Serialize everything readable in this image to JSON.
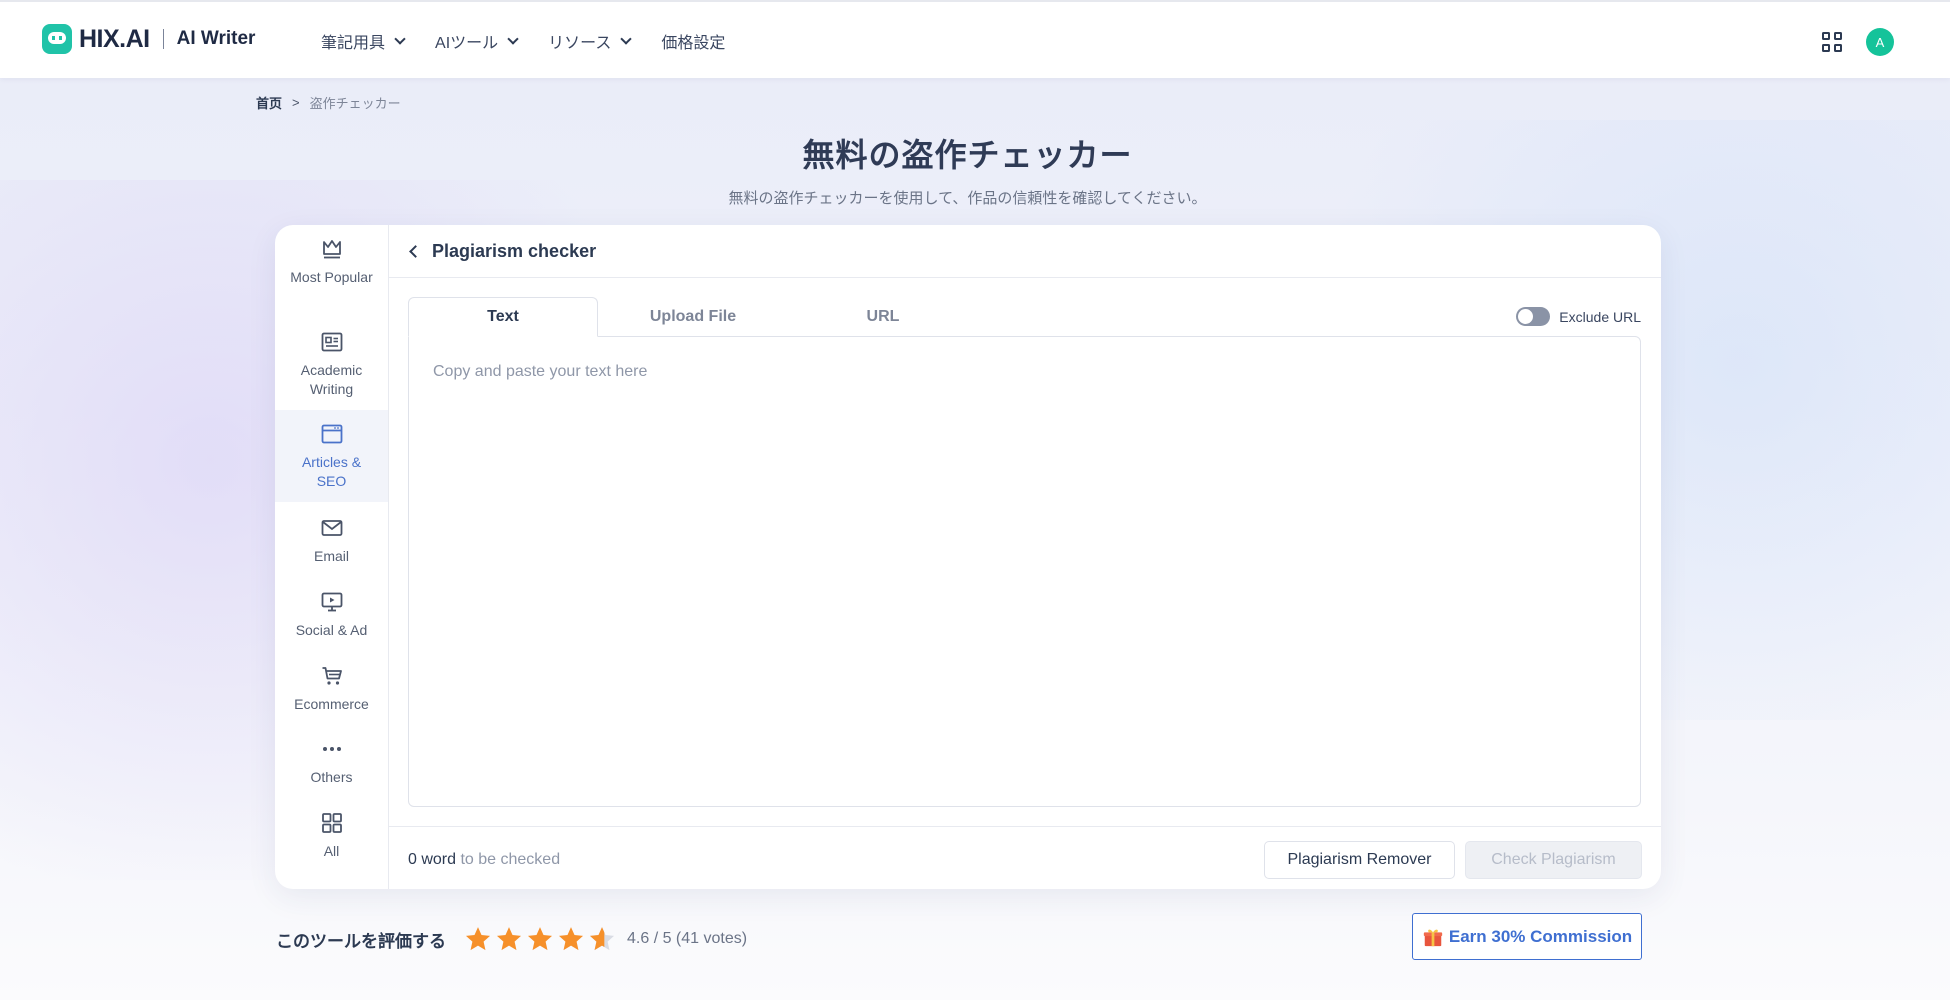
{
  "header": {
    "logo_text": "HIX.AI",
    "product": "AI Writer",
    "nav": [
      {
        "label": "筆記用具",
        "has_dropdown": true
      },
      {
        "label": "AIツール",
        "has_dropdown": true
      },
      {
        "label": "リソース",
        "has_dropdown": true
      },
      {
        "label": "価格設定",
        "has_dropdown": false
      }
    ],
    "avatar_initial": "A"
  },
  "breadcrumb": {
    "home": "首页",
    "separator": ">",
    "current": "盗作チェッカー"
  },
  "page": {
    "title": "無料の盗作チェッカー",
    "subtitle": "無料の盗作チェッカーを使用して、作品の信頼性を確認してください。"
  },
  "sidebar": {
    "items": [
      {
        "label": "Most Popular",
        "icon": "crown-icon"
      },
      {
        "label": "Academic Writing",
        "icon": "newspaper-icon"
      },
      {
        "label": "Articles & SEO",
        "icon": "browser-icon",
        "active": true
      },
      {
        "label": "Email",
        "icon": "mail-icon"
      },
      {
        "label": "Social & Ad",
        "icon": "monitor-play-icon"
      },
      {
        "label": "Ecommerce",
        "icon": "cart-icon"
      },
      {
        "label": "Others",
        "icon": "ellipsis-icon"
      },
      {
        "label": "All",
        "icon": "grid-icon"
      }
    ]
  },
  "panel": {
    "title": "Plagiarism checker",
    "tabs": [
      "Text",
      "Upload File",
      "URL"
    ],
    "active_tab": "Text",
    "exclude_url_label": "Exclude URL",
    "exclude_url_on": false,
    "textarea_placeholder": "Copy and paste your text here",
    "textarea_value": "",
    "word_count_number": "0 word",
    "word_count_suffix": " to be checked",
    "remover_button": "Plagiarism Remover",
    "check_button": "Check Plagiarism"
  },
  "rating": {
    "label": "このツールを評価する",
    "score": 4.6,
    "max": 5,
    "text": "4.6 / 5 (41 votes)"
  },
  "earn": {
    "label": "Earn 30% Commission"
  },
  "colors": {
    "brand_teal": "#20c3a8",
    "accent_blue": "#3f6fd1",
    "active_side": "#4a72c9",
    "star_orange": "#f6902a",
    "avatar": "#15c39a"
  }
}
